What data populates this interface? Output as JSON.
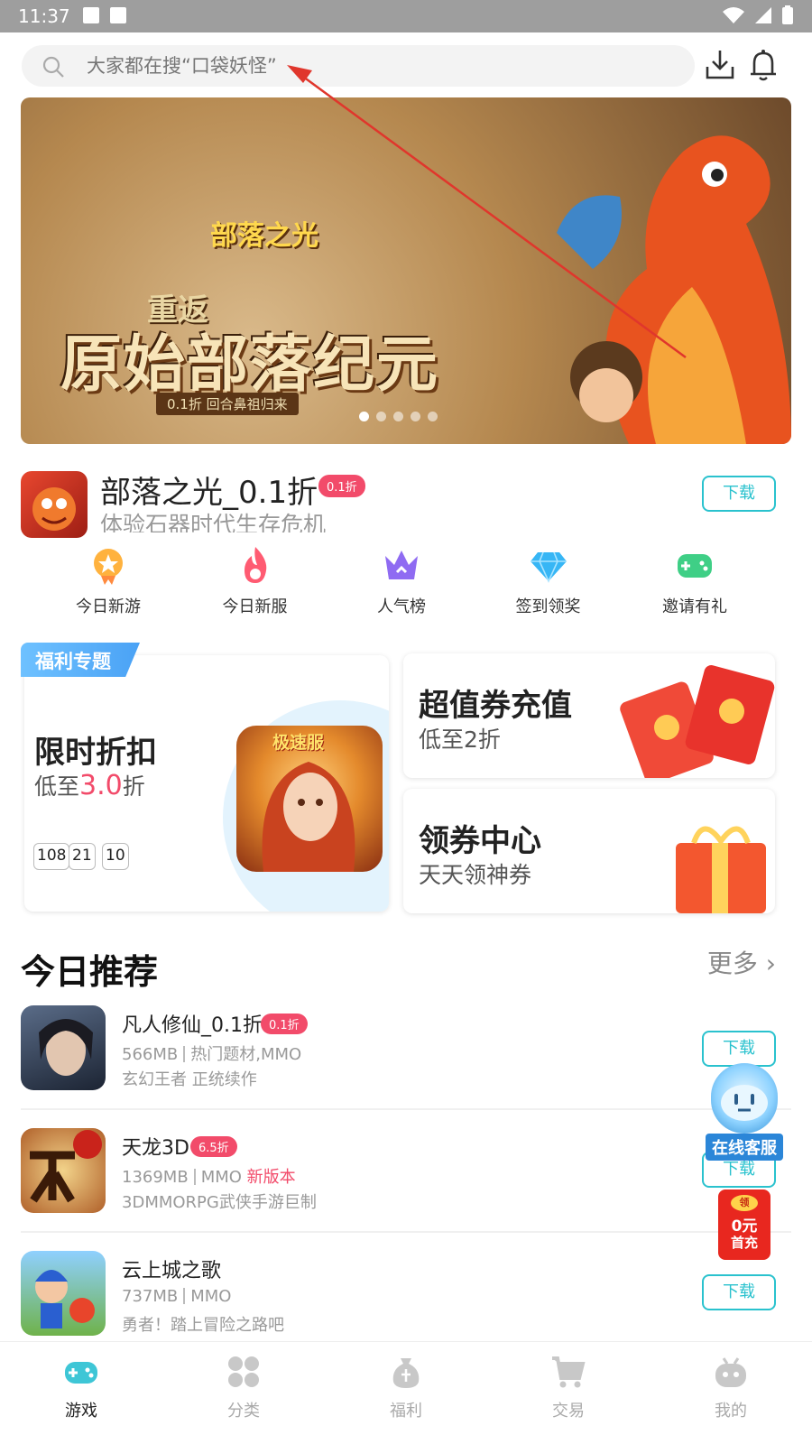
{
  "status_bar": {
    "time": "11:37"
  },
  "search": {
    "placeholder": "大家都在搜“口袋妖怪”"
  },
  "banner": {
    "logo": "部落之光",
    "subtitle": "重返",
    "title": "原始部落纪元",
    "note": "0.1折 回合鼻祖归来",
    "slides": 5,
    "active_slide": 1
  },
  "featured": {
    "name": "部落之光_0.1折",
    "tag": "0.1折",
    "desc": "体验石器时代生存危机",
    "download": "下载"
  },
  "quick_links": [
    {
      "label": "今日新游",
      "icon": "medal-icon"
    },
    {
      "label": "今日新服",
      "icon": "flame-icon"
    },
    {
      "label": "人气榜",
      "icon": "crown-icon"
    },
    {
      "label": "签到领奖",
      "icon": "diamond-icon"
    },
    {
      "label": "邀请有礼",
      "icon": "gamepad-icon"
    }
  ],
  "welfare": {
    "tag": "福利专题",
    "limited": {
      "title": "限时折扣",
      "sub_prefix": "低至",
      "sub_value": "3.0",
      "sub_suffix": "折",
      "countdown": [
        "108",
        "21",
        "10"
      ],
      "art_tag": "极速服"
    },
    "voucher": {
      "title": "超值券充值",
      "sub": "低至2折"
    },
    "coupon": {
      "title": "领券中心",
      "sub": "天天领神券"
    }
  },
  "recommend": {
    "title": "今日推荐",
    "more": "更多",
    "items": [
      {
        "name": "凡人修仙_0.1折",
        "tag": "0.1折",
        "size": "566MB",
        "genre": "热门题材,MMO",
        "extra": "",
        "desc": "玄幻王者 正统续作",
        "download": "下载"
      },
      {
        "name": "天龙3D",
        "tag": "6.5折",
        "size": "1369MB",
        "genre": "MMO",
        "extra": "新版本",
        "desc": "3DMMORPG武侠手游巨制",
        "download": "下载"
      },
      {
        "name": "云上城之歌",
        "tag": "",
        "size": "737MB",
        "genre": "MMO",
        "extra": "",
        "desc": "勇者！踏上冒险之路吧",
        "download": "下载"
      }
    ]
  },
  "floating": {
    "service": "在线客服",
    "red_coin": "领",
    "red_line1": "0元",
    "red_line2": "首充"
  },
  "tabs": [
    {
      "label": "游戏",
      "active": true
    },
    {
      "label": "分类",
      "active": false
    },
    {
      "label": "福利",
      "active": false
    },
    {
      "label": "交易",
      "active": false
    },
    {
      "label": "我的",
      "active": false
    }
  ],
  "colors": {
    "accent": "#2ac2ce",
    "discount": "#f24b6a",
    "welfare_blue": "#4aa2f5",
    "annotation_arrow": "#e0362c"
  }
}
